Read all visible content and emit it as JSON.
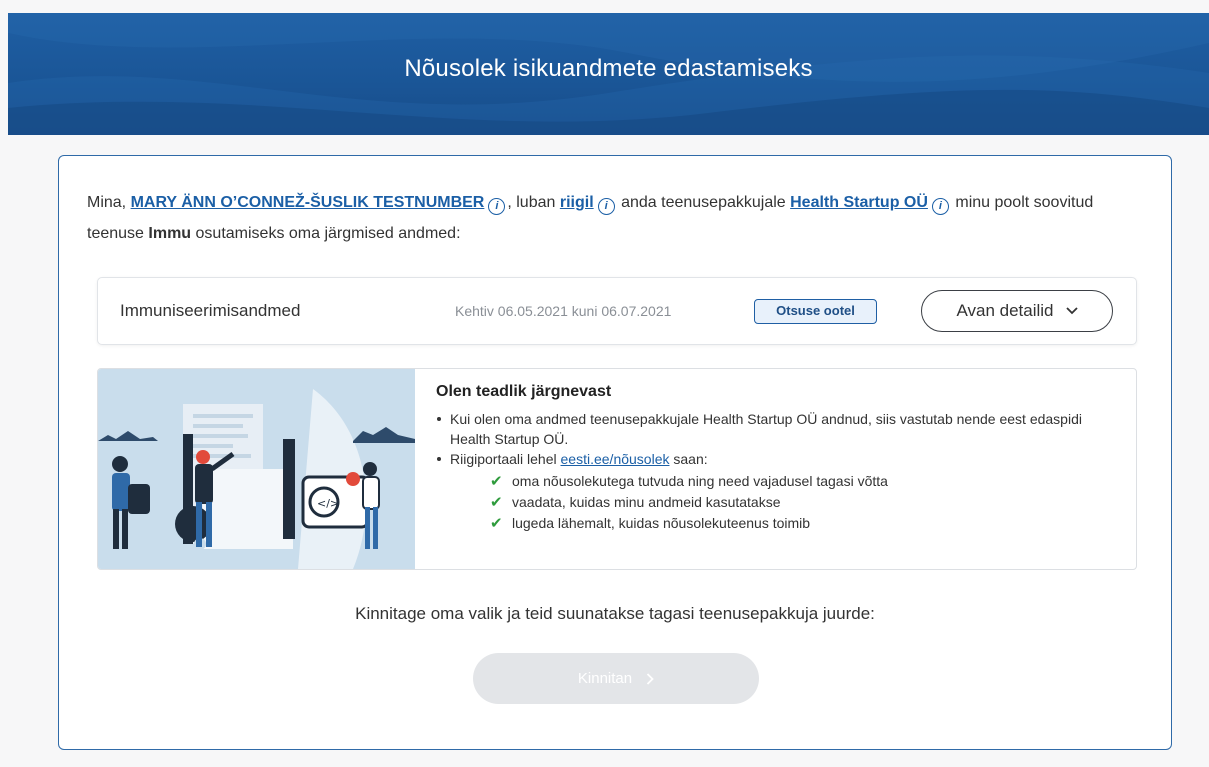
{
  "header": {
    "title": "Nõusolek isikuandmete edastamiseks"
  },
  "intro": {
    "prefix": "Mina,",
    "person_name": "MARY ÄNN O’CONNEŽ-ŠUSLIK TESTNUMBER",
    "mid1": ", luban",
    "state_link": "riigil",
    "mid2": "anda teenusepakkujale",
    "provider_link": "Health Startup OÜ",
    "mid3": "minu poolt soovitud teenuse",
    "service_name": "Immu",
    "suffix": "osutamiseks oma järgmised andmed:",
    "info_icon": "i"
  },
  "data_row": {
    "name": "Immuniseerimisandmed",
    "validity": "Kehtiv 06.05.2021 kuni 06.07.2021",
    "status_badge": "Otsuse ootel",
    "details_button": "Avan detailid",
    "details_icon": "chevron-down-icon"
  },
  "info_box": {
    "heading": "Olen teadlik järgnevast",
    "item1": "Kui olen oma andmed teenusepakkujale Health Startup OÜ andnud, siis vastutab nende eest edaspidi Health Startup OÜ.",
    "item2_prefix": "Riigiportaali lehel",
    "item2_link": "eesti.ee/nõusolek",
    "item2_suffix": "saan:",
    "checks": [
      "oma nõusolekutega tutvuda ning need vajadusel tagasi võtta",
      "vaadata, kuidas minu andmeid kasutatakse",
      "lugeda lähemalt, kuidas nõusolekuteenus toimib"
    ],
    "check_icon": "checkmark-icon",
    "illustration_bubble": "</>"
  },
  "confirm": {
    "text": "Kinnitage oma valik ja teid suunatakse tagasi teenusepakkuja juurde:",
    "button_label": "Kinnitan",
    "button_icon": "chevron-right-icon",
    "button_state": "disabled"
  },
  "colors": {
    "banner": "#1a5596",
    "accent": "#1b5fa6",
    "check_green": "#2e9b3c",
    "button_disabled": "#e3e5e8"
  }
}
